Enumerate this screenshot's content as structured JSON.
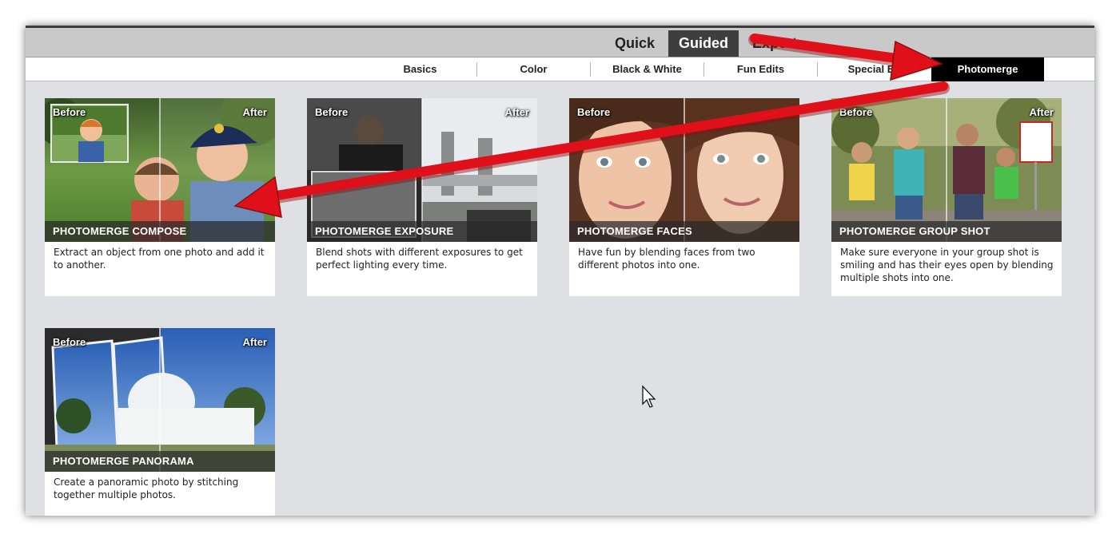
{
  "modes": [
    {
      "label": "Quick",
      "active": false
    },
    {
      "label": "Guided",
      "active": true
    },
    {
      "label": "Expert",
      "active": false
    }
  ],
  "subtabs": [
    {
      "label": "Basics",
      "active": false
    },
    {
      "label": "Color",
      "active": false
    },
    {
      "label": "Black & White",
      "active": false
    },
    {
      "label": "Fun Edits",
      "active": false
    },
    {
      "label": "Special Ed",
      "active": false
    },
    {
      "label": "Photomerge",
      "active": true
    }
  ],
  "cards": [
    {
      "before": "Before",
      "after": "After",
      "title": "PHOTOMERGE COMPOSE",
      "description": "Extract an object from one photo and add it to another."
    },
    {
      "before": "Before",
      "after": "After",
      "title": "PHOTOMERGE EXPOSURE",
      "description": "Blend shots with different exposures to get perfect lighting every time."
    },
    {
      "before": "Before",
      "title": "PHOTOMERGE FACES",
      "description": "Have fun by blending faces from two different photos into one."
    },
    {
      "before": "Before",
      "after": "After",
      "title": "PHOTOMERGE GROUP SHOT",
      "description": "Make sure everyone in your group shot is smiling and has their eyes open by blending multiple shots into one."
    },
    {
      "before": "Before",
      "after": "After",
      "title": "PHOTOMERGE PANORAMA",
      "description": "Create a panoramic photo by stitching together multiple photos."
    }
  ],
  "colors": {
    "annotation_arrow": "#e0101a",
    "active_tab": "#000000",
    "panel": "#dfe0e3"
  },
  "icons": {
    "cursor": "mouse-pointer-icon",
    "arrows": "annotation-arrow"
  }
}
